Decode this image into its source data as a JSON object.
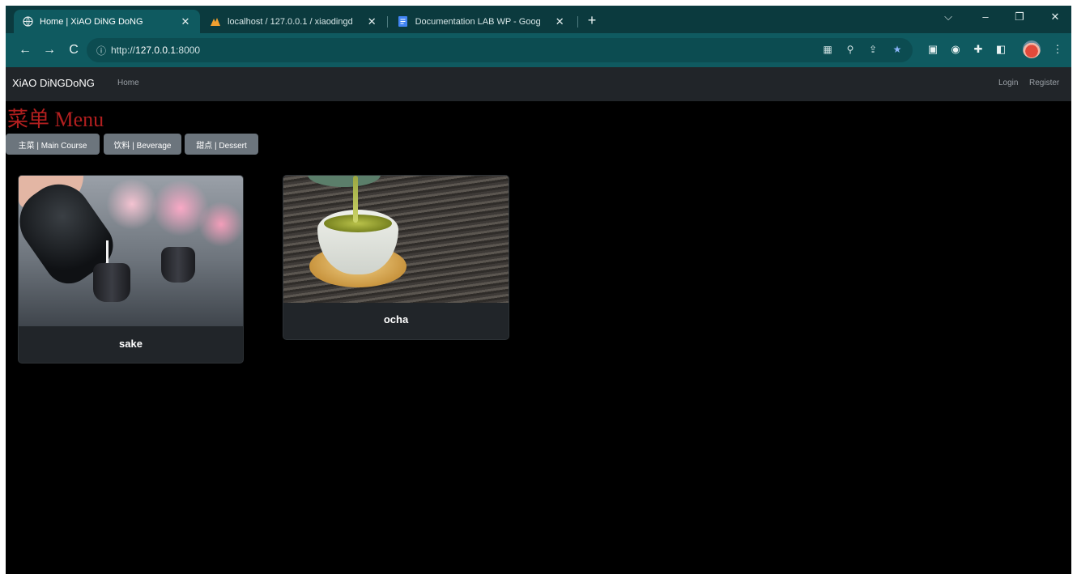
{
  "browser": {
    "tabs": [
      {
        "title": "Home | XiAO DiNG DoNG",
        "active": true,
        "icon": "globe-icon"
      },
      {
        "title": "localhost / 127.0.0.1 / xiaodingd",
        "active": false,
        "icon": "phpmyadmin-icon"
      },
      {
        "title": "Documentation LAB WP - Goog",
        "active": false,
        "icon": "docs-icon"
      }
    ],
    "url_host": "http://",
    "url_bold": "127.0.0.1",
    "url_port": ":8000",
    "accent": "#0f5a60"
  },
  "navbar": {
    "brand": "XiAO DiNGDoNG",
    "home": "Home",
    "login": "Login",
    "register": "Register"
  },
  "page": {
    "title": "菜单 Menu",
    "title_color": "#b21f1f",
    "categories": [
      "主菜 | Main Course",
      "饮料 | Beverage",
      "甜点 | Dessert"
    ],
    "items": [
      {
        "name": "sake"
      },
      {
        "name": "ocha"
      }
    ]
  }
}
